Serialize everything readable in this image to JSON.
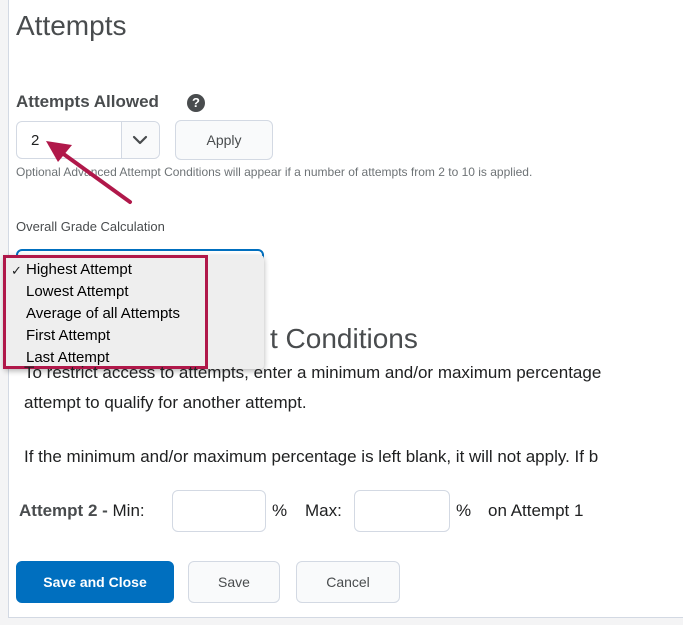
{
  "section": {
    "title": "Attempts"
  },
  "attempts_allowed": {
    "label": "Attempts Allowed",
    "help_icon": "question-circle-icon",
    "value": "2",
    "apply_label": "Apply",
    "helptext": "Optional Advanced Attempt Conditions will appear if a number of attempts from 2 to 10 is applied."
  },
  "overall": {
    "label": "Overall Grade Calculation",
    "options": [
      "Highest Attempt",
      "Lowest Attempt",
      "Average of all Attempts",
      "First Attempt",
      "Last Attempt"
    ],
    "selected": "Highest Attempt",
    "check": "✓"
  },
  "conditions": {
    "title": "Advanced Attempt Conditions",
    "visible_title": "t Conditions",
    "desc_line1": "To restrict access to attempts, enter a minimum and/or maximum percentage",
    "desc_line2": "attempt to qualify for another attempt.",
    "desc_line3": "If the minimum and/or maximum percentage is left blank, it will not apply. If b",
    "row": {
      "attempt_label": "Attempt 2 -",
      "min_label": "Min:",
      "min_value": "",
      "pct1": "%",
      "max_label": "Max:",
      "max_value": "",
      "pct2": "%",
      "suffix": "on Attempt 1"
    }
  },
  "footer": {
    "save_close": "Save and Close",
    "save": "Save",
    "cancel": "Cancel"
  },
  "colors": {
    "primary": "#006fbf",
    "annotation": "#b0184a"
  }
}
